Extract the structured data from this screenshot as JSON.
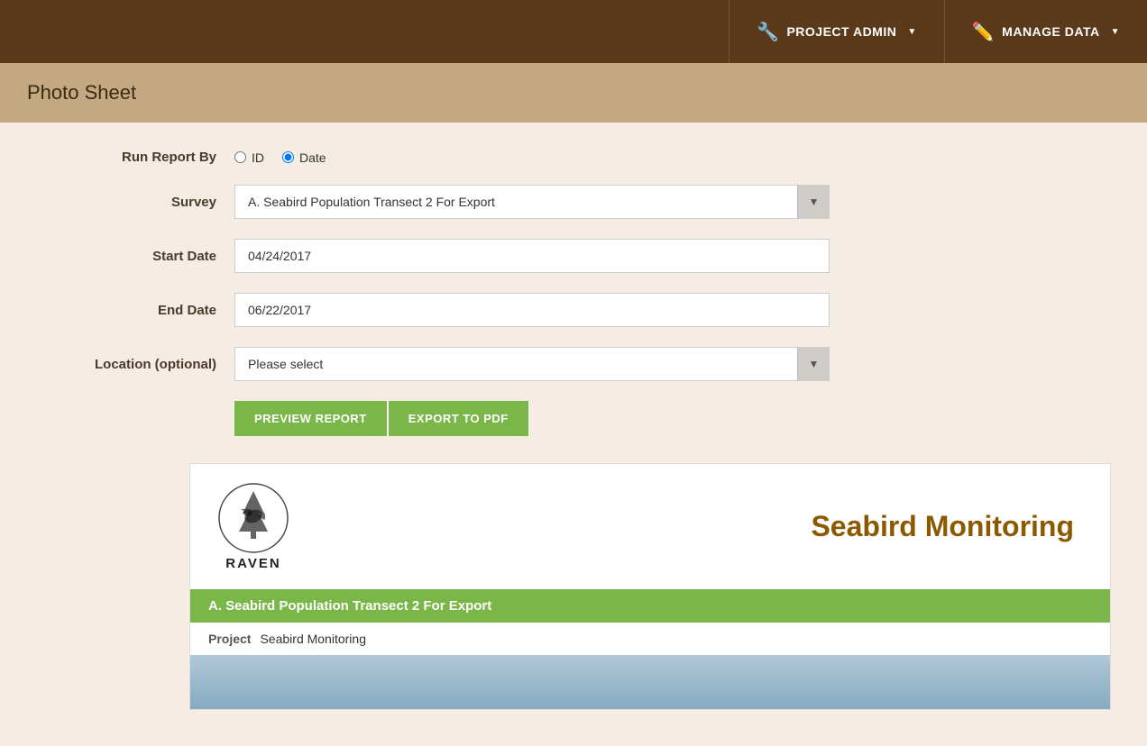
{
  "navbar": {
    "project_admin_label": "PROJECT ADMIN",
    "manage_data_label": "MANAGE DATA"
  },
  "page_title": "Photo Sheet",
  "form": {
    "run_report_by_label": "Run Report By",
    "run_report_by_options": [
      {
        "value": "id",
        "label": "ID"
      },
      {
        "value": "date",
        "label": "Date"
      }
    ],
    "run_report_by_selected": "date",
    "survey_label": "Survey",
    "survey_value": "A. Seabird Population Transect 2 For Export",
    "survey_placeholder": "A. Seabird Population Transect 2 For Export",
    "start_date_label": "Start Date",
    "start_date_value": "04/24/2017",
    "end_date_label": "End Date",
    "end_date_value": "06/22/2017",
    "location_label": "Location (optional)",
    "location_placeholder": "Please select",
    "preview_report_btn": "PREVIEW REPORT",
    "export_pdf_btn": "EXPORT TO PDF"
  },
  "report_preview": {
    "raven_label": "RAVEN",
    "title": "Seabird Monitoring",
    "survey_bar_text": "A. Seabird Population Transect 2 For Export",
    "project_label": "Project",
    "project_value": "Seabird Monitoring"
  }
}
